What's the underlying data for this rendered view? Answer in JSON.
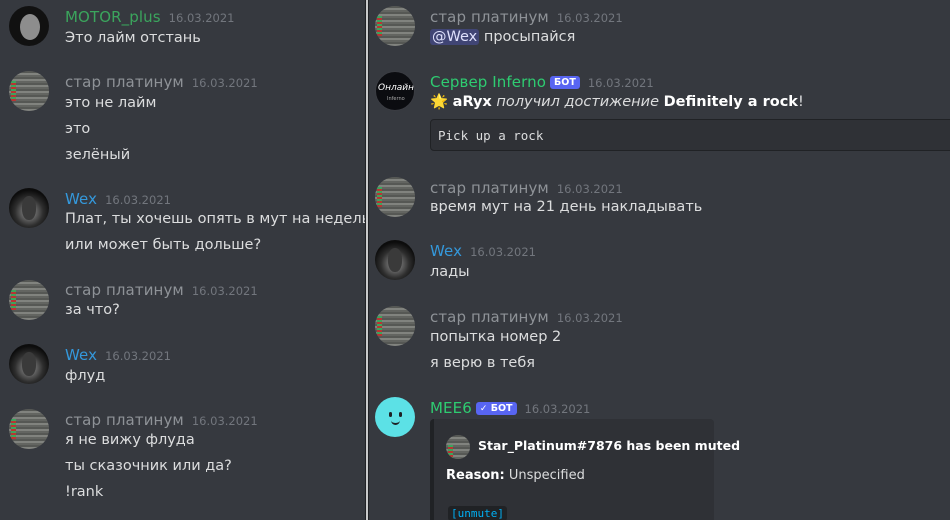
{
  "colors": {
    "motor_name": "#3ba55d",
    "star_name": "#8e9297",
    "wex_name": "#3498db",
    "inferno_name": "#2ecc71",
    "mee6_name": "#2ecc71",
    "bot_badge": "#5865f2",
    "background": "#36393f"
  },
  "left": {
    "messages": [
      {
        "author": "MOTOR_plus",
        "timestamp": "16.03.2021",
        "lines": [
          "Это лайм отстань"
        ]
      },
      {
        "author": "стар платинум",
        "timestamp": "16.03.2021",
        "lines": [
          "это не лайм",
          "это",
          "зелёный"
        ]
      },
      {
        "author": "Wex",
        "timestamp": "16.03.2021",
        "lines": [
          "Плат, ты хочешь опять в мут на недельку?",
          "или может быть дольше?"
        ]
      },
      {
        "author": "стар платинум",
        "timestamp": "16.03.2021",
        "lines": [
          "за что?"
        ]
      },
      {
        "author": "Wex",
        "timestamp": "16.03.2021",
        "lines": [
          "флуд"
        ]
      },
      {
        "author": "стар платинум",
        "timestamp": "16.03.2021",
        "lines": [
          "я не вижу флуда",
          "ты сказочник или да?",
          "!rank"
        ]
      }
    ]
  },
  "right": {
    "m1": {
      "author": "стар платинум",
      "timestamp": "16.03.2021",
      "mention": "@Wex",
      "text": "просыпайся"
    },
    "m2": {
      "author": "Сервер Inferno",
      "badge": "БОТ",
      "timestamp": "16.03.2021",
      "avatar_text": "Онлайн",
      "avatar_subtext": "Inferno",
      "emoji": "🌟",
      "user": "aRyx",
      "action": "получил достижение",
      "achievement": "Definitely a rock",
      "end": "!",
      "code": "Pick up a rock"
    },
    "m3": {
      "author": "стар платинум",
      "timestamp": "16.03.2021",
      "lines": [
        "время мут на 21 день накладывать"
      ]
    },
    "m4": {
      "author": "Wex",
      "timestamp": "16.03.2021",
      "lines": [
        "лады"
      ]
    },
    "m5": {
      "author": "стар платинум",
      "timestamp": "16.03.2021",
      "lines": [
        "попытка номер 2",
        "я верю в тебя"
      ]
    },
    "m6": {
      "author": "MEE6",
      "badge_check": "✓",
      "badge": "БОТ",
      "timestamp": "16.03.2021",
      "embed": {
        "title": "Star_Platinum#7876 has been muted",
        "reason_label": "Reason:",
        "reason_value": "Unspecified",
        "link": "[unmute]"
      }
    }
  }
}
